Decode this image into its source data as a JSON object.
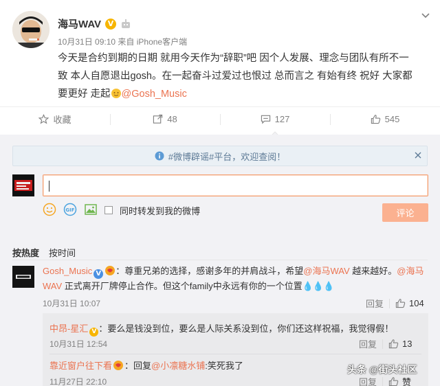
{
  "post": {
    "author": "海马WAV",
    "meta": "10月31日 09:10 来自 iPhone客户端",
    "lines": [
      "今天是合约到期的日期 就用今天作为“辞职”吧 因个人发展、理念与团队有所不一",
      "致 本人自愿退出gosh。在一起奋斗过爱过也恨过 总而言之 有始有终 祝好 大家都"
    ],
    "line3_text": "要更好 走起",
    "line3_mention": "@Gosh_Music"
  },
  "actions": {
    "favorite": "收藏",
    "repost_count": "48",
    "comment_count": "127",
    "like_count": "545"
  },
  "notice": {
    "text": "#微博辟谣#平台，欢迎查阅！"
  },
  "composer": {
    "input_value": "",
    "also_repost_label": "同时转发到我的微博",
    "submit_label": "评论"
  },
  "sort": {
    "hot": "按热度",
    "time": "按时间"
  },
  "comments": [
    {
      "user": "Gosh_Music",
      "line1_pre": "：尊重兄弟的选择，感谢多年的并肩战斗，希望",
      "line1_mention1": "@海马WAV",
      "line1_post": " 越来越好。",
      "line1_mention2": "@海马",
      "line2_mention": "WAV",
      "line2_text": " 正式离开厂牌停止合作。但这个family中永远有你的一个位置",
      "time": "10月31日 10:07",
      "reply_label": "回复",
      "likes": "104"
    }
  ],
  "subcomments": [
    {
      "user": "中昂-星汇",
      "text": "：要么是钱没到位，要么是人际关系没到位，你们还这样祝福，我觉得假！",
      "time": "10月31日 12:54",
      "reply_label": "回复",
      "likes": "13"
    },
    {
      "user": "靠近窗户往下看",
      "text_pre": "：回复",
      "mention": "@小凛糖水铺",
      "text_post": ":笑死我了",
      "time": "11月27日 22:10",
      "reply_label": "回复",
      "likes": "赞"
    }
  ],
  "watermark": "头条 @街头社区",
  "colors": {
    "link": "#eb7350",
    "submit_bg": "#fbb190",
    "gray_bg": "#f2f2f5",
    "notice_bg": "#eaf0f5"
  }
}
